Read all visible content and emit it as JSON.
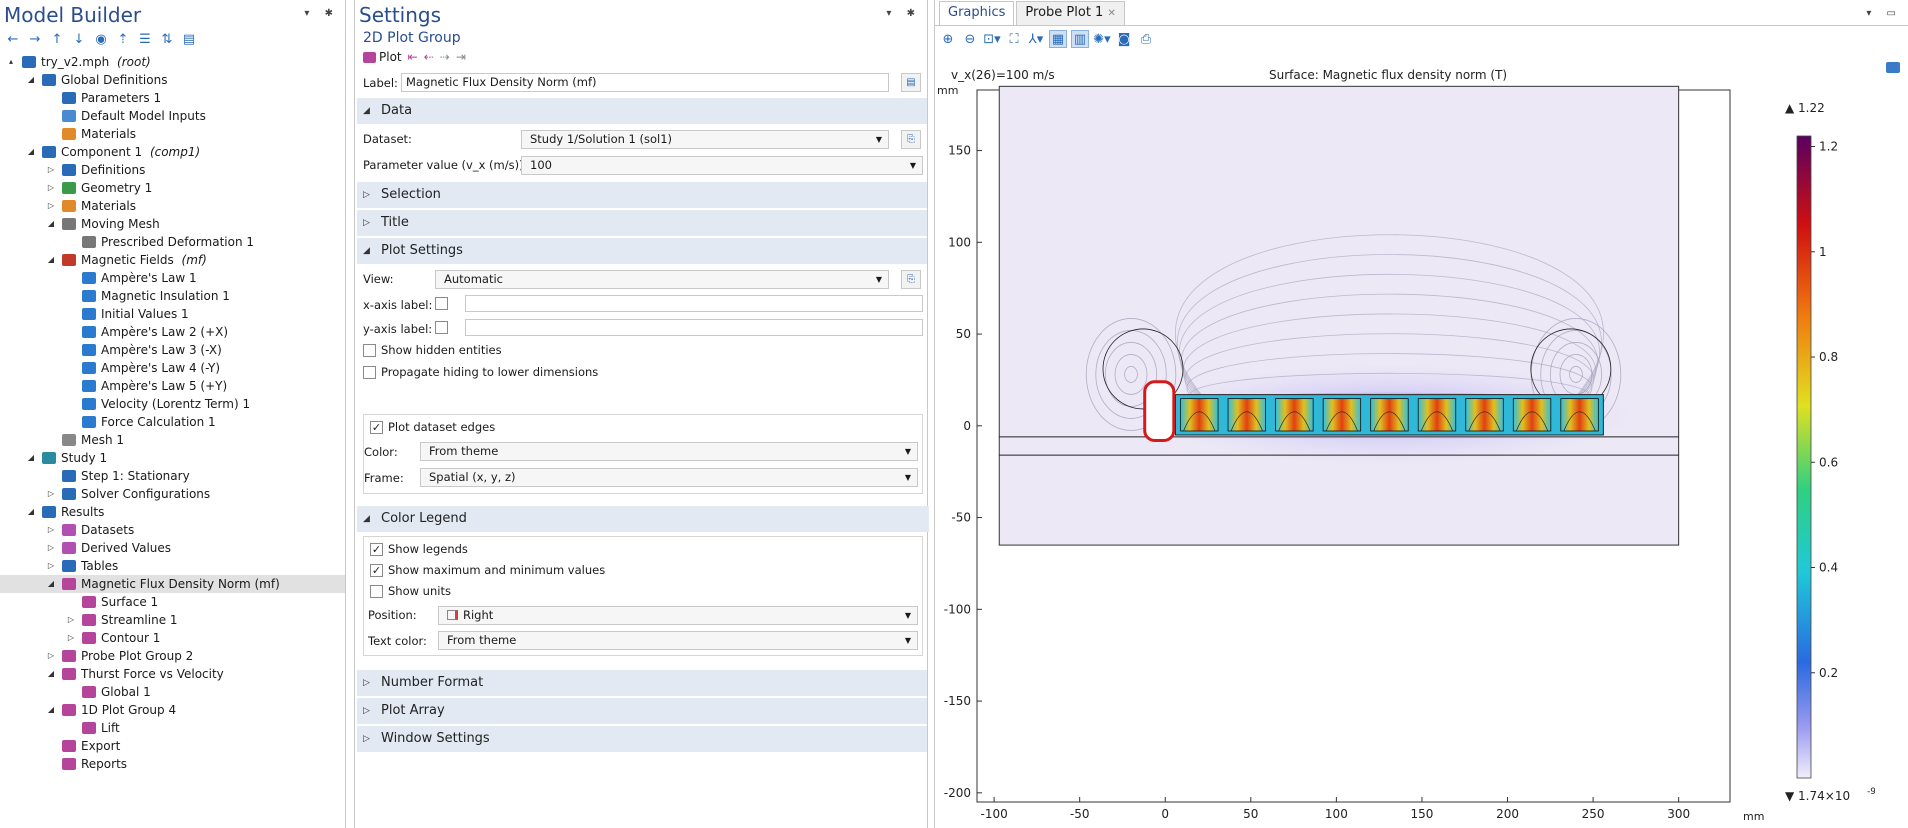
{
  "model_builder": {
    "title": "Model Builder",
    "tree": [
      {
        "label": "try_v2.mph",
        "tag": "(root)",
        "depth": 0,
        "tw": "▴",
        "icon": "#2a6bb8",
        "icon_name": "model-file-icon"
      },
      {
        "label": "Global Definitions",
        "depth": 1,
        "tw": "◢",
        "icon": "#2a6bb8",
        "icon_name": "globe-icon"
      },
      {
        "label": "Parameters 1",
        "depth": 2,
        "icon": "#2a6bb8",
        "icon_name": "parameters-icon"
      },
      {
        "label": "Default Model Inputs",
        "depth": 2,
        "icon": "#4a8ad0",
        "icon_name": "model-inputs-icon"
      },
      {
        "label": "Materials",
        "depth": 2,
        "icon": "#e08a2a",
        "icon_name": "materials-icon"
      },
      {
        "label": "Component 1",
        "tag": "(comp1)",
        "depth": 1,
        "tw": "◢",
        "icon": "#2a6bb8",
        "icon_name": "component-icon"
      },
      {
        "label": "Definitions",
        "depth": 2,
        "tw": "▷",
        "icon": "#2a6bb8",
        "icon_name": "definitions-icon"
      },
      {
        "label": "Geometry 1",
        "depth": 2,
        "tw": "▷",
        "icon": "#3a9a4a",
        "icon_name": "geometry-icon"
      },
      {
        "label": "Materials",
        "depth": 2,
        "tw": "▷",
        "icon": "#e08a2a",
        "icon_name": "materials-icon"
      },
      {
        "label": "Moving Mesh",
        "depth": 2,
        "tw": "◢",
        "icon": "#777777",
        "icon_name": "moving-mesh-icon"
      },
      {
        "label": "Prescribed Deformation 1",
        "depth": 3,
        "icon": "#777777",
        "icon_name": "deformation-icon"
      },
      {
        "label": "Magnetic Fields",
        "tag": "(mf)",
        "depth": 2,
        "tw": "◢",
        "icon": "#c0392b",
        "icon_name": "magnetic-fields-icon"
      },
      {
        "label": "Ampère's Law 1",
        "depth": 3,
        "icon": "#2a7bd0",
        "icon_name": "domain-feature-icon"
      },
      {
        "label": "Magnetic Insulation 1",
        "depth": 3,
        "icon": "#2a7bd0",
        "icon_name": "boundary-feature-icon"
      },
      {
        "label": "Initial Values 1",
        "depth": 3,
        "icon": "#2a7bd0",
        "icon_name": "domain-feature-icon"
      },
      {
        "label": "Ampère's Law 2 (+X)",
        "depth": 3,
        "icon": "#2a7bd0",
        "icon_name": "domain-feature-icon"
      },
      {
        "label": "Ampère's Law 3 (-X)",
        "depth": 3,
        "icon": "#2a7bd0",
        "icon_name": "domain-feature-icon"
      },
      {
        "label": "Ampère's Law 4 (-Y)",
        "depth": 3,
        "icon": "#2a7bd0",
        "icon_name": "domain-feature-icon"
      },
      {
        "label": "Ampère's Law 5 (+Y)",
        "depth": 3,
        "icon": "#2a7bd0",
        "icon_name": "domain-feature-icon"
      },
      {
        "label": "Velocity (Lorentz Term) 1",
        "depth": 3,
        "icon": "#2a7bd0",
        "icon_name": "domain-feature-icon"
      },
      {
        "label": "Force Calculation 1",
        "depth": 3,
        "icon": "#2a7bd0",
        "icon_name": "domain-feature-icon"
      },
      {
        "label": "Mesh 1",
        "depth": 2,
        "icon": "#888888",
        "icon_name": "mesh-icon"
      },
      {
        "label": "Study 1",
        "depth": 1,
        "tw": "◢",
        "icon": "#2a8aa0",
        "icon_name": "study-icon"
      },
      {
        "label": "Step 1: Stationary",
        "depth": 2,
        "icon": "#2a6bb8",
        "icon_name": "stationary-step-icon"
      },
      {
        "label": "Solver Configurations",
        "depth": 2,
        "tw": "▷",
        "icon": "#2a6bb8",
        "icon_name": "solver-icon"
      },
      {
        "label": "Results",
        "depth": 1,
        "tw": "◢",
        "icon": "#2a6bb8",
        "icon_name": "results-icon"
      },
      {
        "label": "Datasets",
        "depth": 2,
        "tw": "▷",
        "icon": "#b050b0",
        "icon_name": "datasets-icon"
      },
      {
        "label": "Derived Values",
        "depth": 2,
        "tw": "▷",
        "icon": "#b050b0",
        "icon_name": "derived-values-icon"
      },
      {
        "label": "Tables",
        "depth": 2,
        "tw": "▷",
        "icon": "#2a6bb8",
        "icon_name": "tables-icon"
      },
      {
        "label": "Magnetic Flux Density Norm (mf)",
        "depth": 2,
        "tw": "◢",
        "icon": "#b5459b",
        "icon_name": "plot-group-2d-icon",
        "selected": true
      },
      {
        "label": "Surface 1",
        "depth": 3,
        "icon": "#b5459b",
        "icon_name": "surface-plot-icon"
      },
      {
        "label": "Streamline 1",
        "depth": 3,
        "tw": "▷",
        "icon": "#b5459b",
        "icon_name": "streamline-icon"
      },
      {
        "label": "Contour 1",
        "depth": 3,
        "tw": "▷",
        "icon": "#b5459b",
        "icon_name": "contour-icon"
      },
      {
        "label": "Probe Plot Group 2",
        "depth": 2,
        "tw": "▷",
        "icon": "#b5459b",
        "icon_name": "plot-group-1d-icon"
      },
      {
        "label": "Thurst Force vs Velocity",
        "depth": 2,
        "tw": "◢",
        "icon": "#b5459b",
        "icon_name": "plot-group-1d-icon"
      },
      {
        "label": "Global 1",
        "depth": 3,
        "icon": "#b5459b",
        "icon_name": "global-plot-icon"
      },
      {
        "label": "1D Plot Group 4",
        "depth": 2,
        "tw": "◢",
        "icon": "#b5459b",
        "icon_name": "plot-group-1d-icon"
      },
      {
        "label": "Lift",
        "depth": 3,
        "icon": "#b5459b",
        "icon_name": "global-plot-icon"
      },
      {
        "label": "Export",
        "depth": 2,
        "icon": "#b5459b",
        "icon_name": "export-icon"
      },
      {
        "label": "Reports",
        "depth": 2,
        "icon": "#b5459b",
        "icon_name": "reports-icon"
      }
    ]
  },
  "settings": {
    "title": "Settings",
    "subtitle": "2D Plot Group",
    "plot_button": "Plot",
    "label_caption": "Label:",
    "label_value": "Magnetic Flux Density Norm (mf)",
    "sections": {
      "data": "Data",
      "selection": "Selection",
      "title": "Title",
      "plot_settings": "Plot Settings",
      "color_legend": "Color Legend",
      "number_format": "Number Format",
      "plot_array": "Plot Array",
      "window_settings": "Window Settings"
    },
    "dataset_label": "Dataset:",
    "dataset_value": "Study 1/Solution 1 (sol1)",
    "param_label": "Parameter value (v_x (m/s)):",
    "param_value": "100",
    "view_label": "View:",
    "view_value": "Automatic",
    "xaxis_label": "x-axis label:",
    "yaxis_label": "y-axis label:",
    "show_hidden": "Show hidden entities",
    "propagate": "Propagate hiding to lower dimensions",
    "plot_edges": "Plot dataset edges",
    "color_label": "Color:",
    "color_value": "From theme",
    "frame_label": "Frame:",
    "frame_value": "Spatial  (x, y, z)",
    "show_legends": "Show legends",
    "show_maxmin": "Show maximum and minimum values",
    "show_units": "Show units",
    "position_label": "Position:",
    "position_value": "Right",
    "textcolor_label": "Text color:",
    "textcolor_value": "From theme"
  },
  "graphics": {
    "tab_graphics": "Graphics",
    "tab_probe": "Probe Plot 1",
    "close_glyph": "✕",
    "param_title": "v_x(26)=100 m/s",
    "plot_title": "Surface: Magnetic flux density norm (T)",
    "unit_mm": "mm"
  },
  "chart_data": {
    "type": "heatmap",
    "title": "Surface: Magnetic flux density norm (T)",
    "subtitle": "v_x(26)=100 m/s",
    "x_ticks": [
      -100,
      -50,
      0,
      50,
      100,
      150,
      200,
      250,
      300
    ],
    "y_ticks": [
      150,
      100,
      50,
      0,
      -50,
      -100,
      -150,
      -200
    ],
    "xlim": [
      -110,
      330
    ],
    "ylim": [
      -205,
      183
    ],
    "xlabel": "mm",
    "ylabel": "mm",
    "colorbar": {
      "max_label": "▲ 1.22",
      "min_label": "▼ 1.74×10",
      "min_exp": "-9",
      "ticks": [
        "1.2",
        "1",
        "0.8",
        "0.6",
        "0.4",
        "0.2"
      ],
      "tick_values": [
        1.2,
        1.0,
        0.8,
        0.6,
        0.4,
        0.2
      ],
      "range": [
        0,
        1.22
      ]
    },
    "geometry": {
      "outer_box": [
        -97,
        -65,
        300,
        185
      ],
      "airgap_lines_y": [
        -6,
        -16
      ],
      "magnet_array": [
        6,
        -5,
        250,
        22
      ],
      "slot_count": 9
    }
  }
}
